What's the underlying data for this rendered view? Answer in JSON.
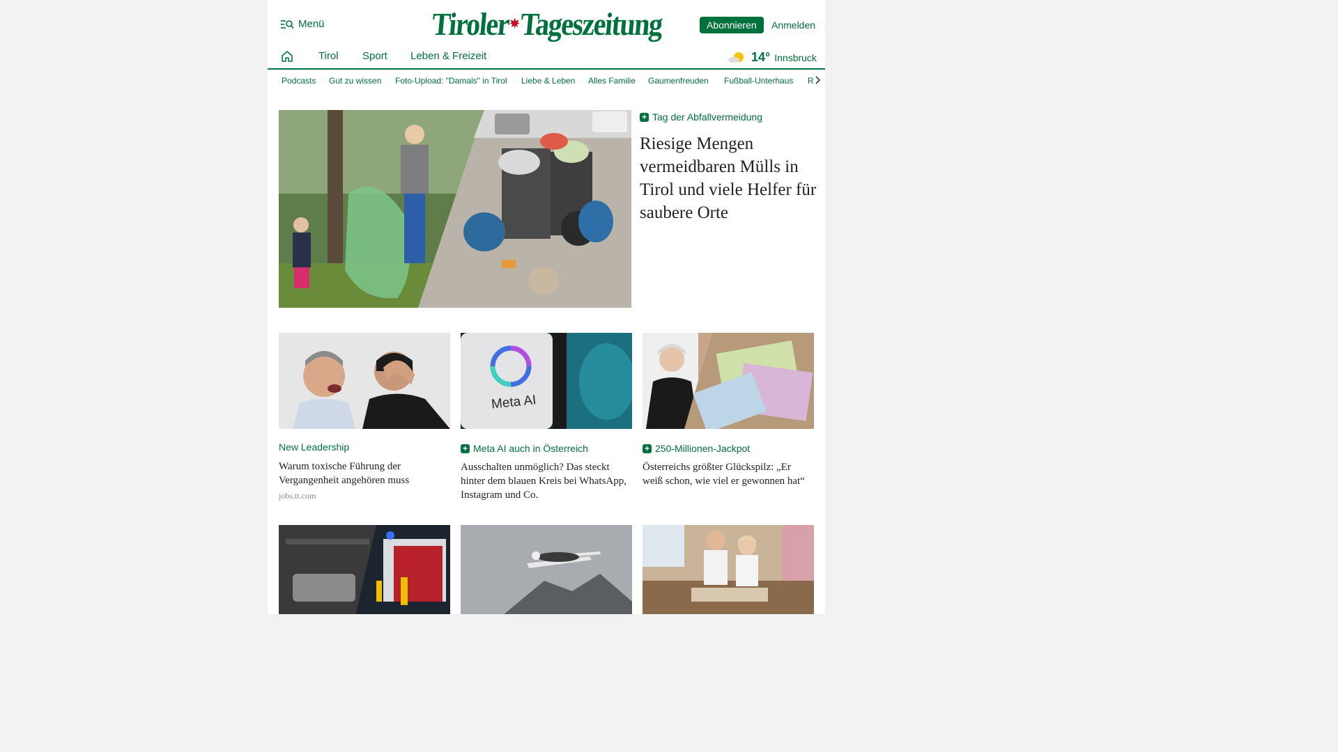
{
  "header": {
    "menu_label": "Menü",
    "logo_left": "Tiroler",
    "logo_right": "Tageszeitung",
    "subscribe_label": "Abonnieren",
    "login_label": "Anmelden"
  },
  "main_nav": {
    "items": [
      {
        "label": "Tirol"
      },
      {
        "label": "Sport"
      },
      {
        "label": "Leben & Freizeit"
      }
    ]
  },
  "weather": {
    "temperature": "14°",
    "city": "Innsbruck",
    "icon": "sun-cloud-icon"
  },
  "sub_nav": {
    "items": [
      {
        "label": "Podcasts"
      },
      {
        "label": "Gut zu wissen"
      },
      {
        "label": "Foto-Upload: \"Damals\" in Tirol"
      },
      {
        "label": "Liebe & Leben"
      },
      {
        "label": "Alles Familie"
      },
      {
        "label": "Gaumenfreuden"
      },
      {
        "label": "Fußball-Unterhaus"
      },
      {
        "label": "R"
      }
    ]
  },
  "hero": {
    "kicker": "Tag der Abfallvermeidung",
    "title": "Riesige Mengen vermeidbaren Mülls in Tirol und viele Helfer für saubere Orte"
  },
  "cards": [
    {
      "kicker": "New Leadership",
      "premium": false,
      "title": "Warum toxische Führung der Vergangenheit angehören muss",
      "source": "jobs.tt.com"
    },
    {
      "kicker": "Meta AI auch in Österreich",
      "premium": true,
      "title": "Ausschalten unmöglich? Das steckt hinter dem blauen Kreis bei WhatsApp, Instagram und Co.",
      "image_text": "Meta AI"
    },
    {
      "kicker": "250-Millionen-Jackpot",
      "premium": true,
      "title": "Österreichs größter Glückspilz: „Er weiß schon, wie viel er gewonnen hat“"
    }
  ],
  "colors": {
    "brand": "#00703c",
    "text": "#222222",
    "muted": "#888888"
  }
}
